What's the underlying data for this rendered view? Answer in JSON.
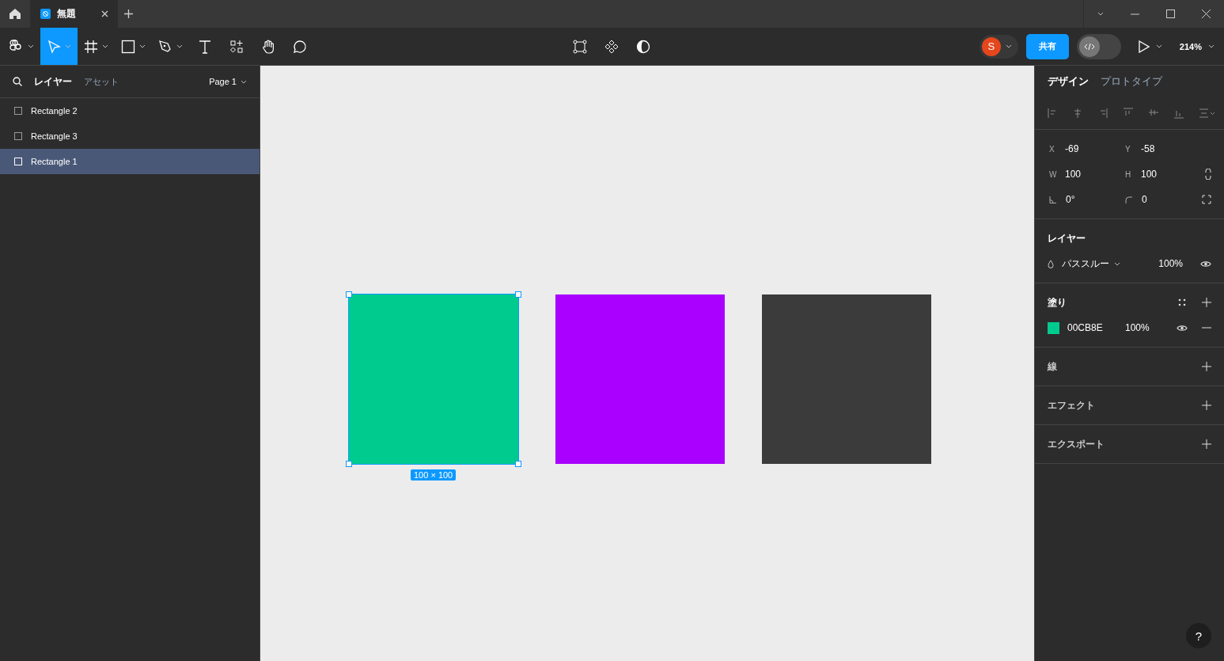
{
  "title_bar": {
    "tabs": [
      {
        "label": "無題",
        "selected": true
      }
    ]
  },
  "toolbar": {
    "tools": [
      {
        "kind": "main-menu",
        "selected": false
      },
      {
        "kind": "move",
        "selected": true
      },
      {
        "kind": "frame",
        "selected": false
      },
      {
        "kind": "shape",
        "selected": false
      },
      {
        "kind": "pen",
        "selected": false
      },
      {
        "kind": "text",
        "selected": false
      },
      {
        "kind": "resources",
        "selected": false
      },
      {
        "kind": "hand",
        "selected": false
      },
      {
        "kind": "comment",
        "selected": false
      }
    ],
    "avatar": "S",
    "share_button": "共有",
    "dev_mode": {
      "on": false
    },
    "zoom": "214%"
  },
  "layers_panel": {
    "tabs": [
      {
        "label": "レイヤー",
        "selected": true
      },
      {
        "label": "アセット",
        "selected": false
      }
    ],
    "page": "Page 1",
    "layers": [
      {
        "name": "Rectangle 2",
        "selected": false
      },
      {
        "name": "Rectangle 3",
        "selected": false
      },
      {
        "name": "Rectangle 1",
        "selected": true
      }
    ]
  },
  "canvas": {
    "shapes": [
      {
        "color": "#00cb8e",
        "selected": true
      },
      {
        "color": "#aa00ff",
        "selected": false
      },
      {
        "color": "#3b3b3b",
        "selected": false
      }
    ],
    "selection_size": "100 × 100"
  },
  "design_panel": {
    "tabs": [
      {
        "label": "デザイン",
        "selected": true
      },
      {
        "label": "プロトタイプ",
        "selected": false
      }
    ],
    "fields": [
      {
        "kind": "label",
        "label": "X",
        "value": "-69"
      },
      {
        "kind": "label",
        "label": "Y",
        "value": "-58"
      },
      {
        "kind": "label",
        "label": "W",
        "value": "100"
      },
      {
        "kind": "label",
        "label": "H",
        "value": "100"
      },
      {
        "kind": "rotation",
        "value": "0°"
      },
      {
        "kind": "radius",
        "value": "0"
      }
    ],
    "layer": {
      "title": "レイヤー",
      "blend": "パススルー",
      "opacity": "100%"
    },
    "fill": {
      "title": "塗り",
      "fills": [
        {
          "hex": "00CB8E",
          "color": "#00cb8e",
          "opacity": "100%"
        }
      ]
    },
    "sections": [
      "線",
      "エフェクト",
      "エクスポート"
    ]
  },
  "help": "?"
}
